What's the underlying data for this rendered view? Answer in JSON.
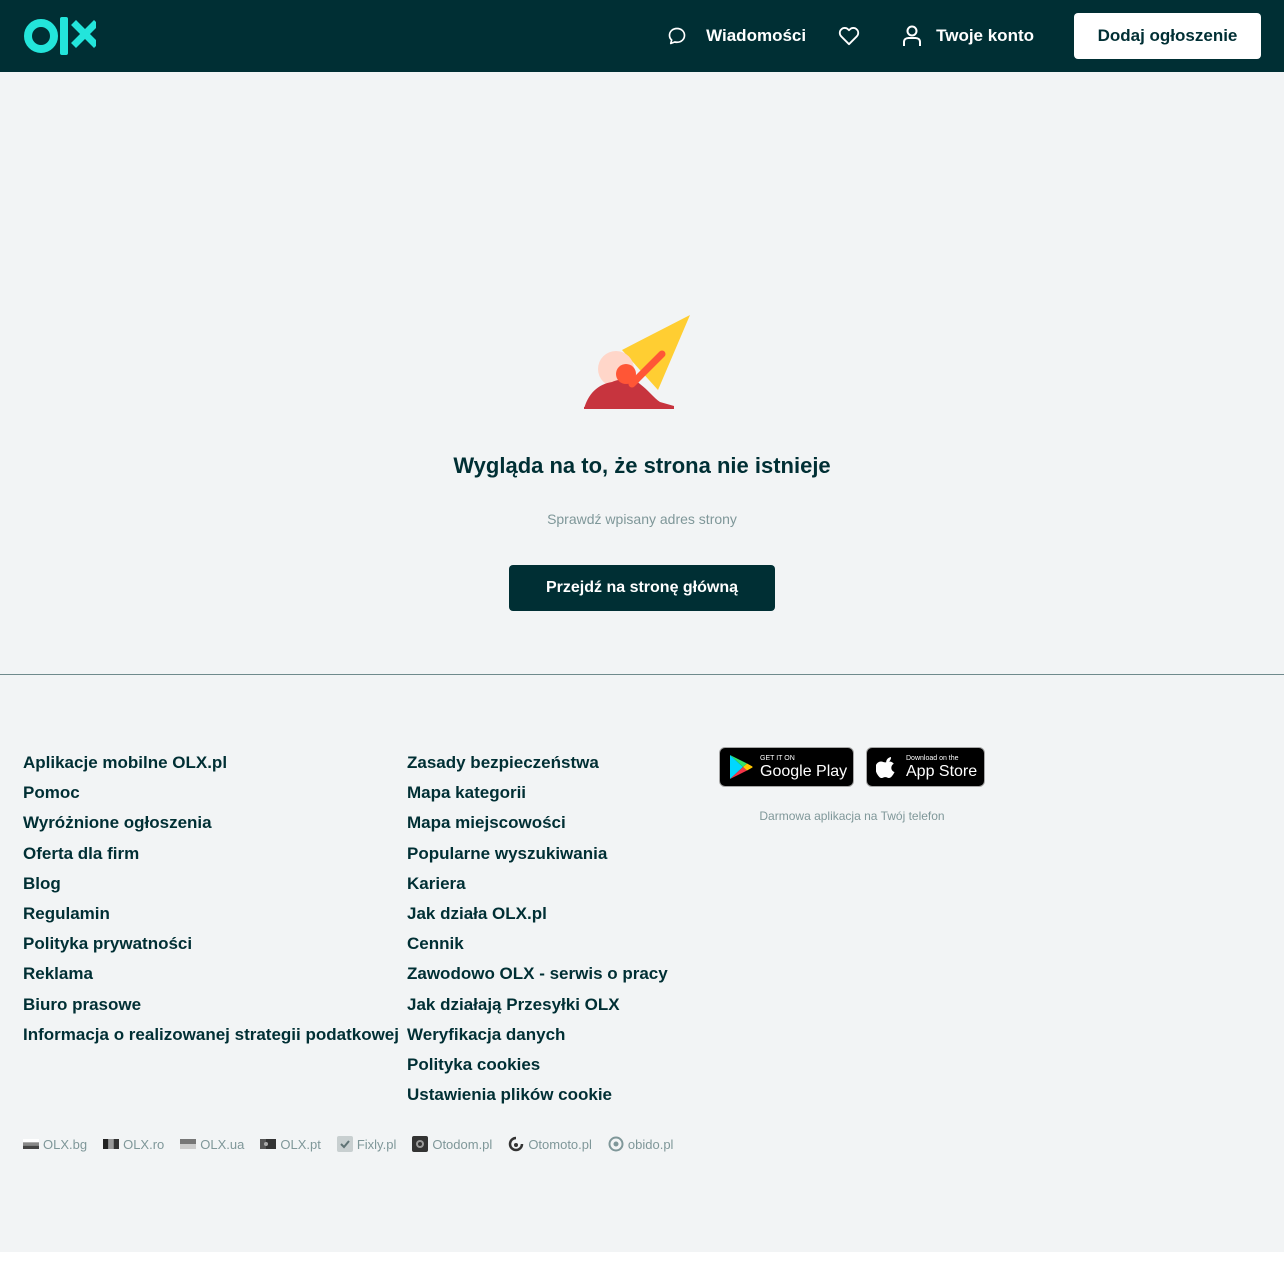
{
  "header": {
    "logo_text": "olx",
    "messages_label": "Wiadomości",
    "account_label": "Twoje konto",
    "add_listing_label": "Dodaj ogłoszenie"
  },
  "error": {
    "title": "Wygląda na to, że strona nie istnieje",
    "subtitle": "Sprawdź wpisany adres strony",
    "home_button": "Przejdź na stronę główną"
  },
  "footer": {
    "column1": [
      "Aplikacje mobilne OLX.pl",
      "Pomoc",
      "Wyróżnione ogłoszenia",
      "Oferta dla firm",
      "Blog",
      "Regulamin",
      "Polityka prywatności",
      "Reklama",
      "Biuro prasowe",
      "Informacja o realizowanej strategii podatkowej"
    ],
    "column2": [
      "Zasady bezpieczeństwa",
      "Mapa kategorii",
      "Mapa miejscowości",
      "Popularne wyszukiwania",
      "Kariera",
      "Jak działa OLX.pl",
      "Cennik",
      "Zawodowo OLX - serwis o pracy",
      "Jak działają Przesyłki OLX",
      "Weryfikacja danych",
      "Polityka cookies",
      "Ustawienia plików cookie"
    ],
    "google_play": {
      "small": "GET IT ON",
      "big": "Google Play"
    },
    "app_store": {
      "small": "Download on the",
      "big": "App Store"
    },
    "apps_caption": "Darmowa aplikacja na Twój telefon",
    "sites": [
      {
        "label": "OLX.bg",
        "icon": "bulgaria-flag-icon"
      },
      {
        "label": "OLX.ro",
        "icon": "romania-flag-icon"
      },
      {
        "label": "OLX.ua",
        "icon": "ukraine-flag-icon"
      },
      {
        "label": "OLX.pt",
        "icon": "portugal-flag-icon"
      },
      {
        "label": "Fixly.pl",
        "icon": "fixly-icon"
      },
      {
        "label": "Otodom.pl",
        "icon": "otodom-icon"
      },
      {
        "label": "Otomoto.pl",
        "icon": "otomoto-icon"
      },
      {
        "label": "obido.pl",
        "icon": "obido-icon"
      }
    ]
  },
  "colors": {
    "brand_dark": "#002f34",
    "brand_teal": "#23e5db",
    "page_bg": "#f2f4f5",
    "muted_text": "#7f9799"
  }
}
